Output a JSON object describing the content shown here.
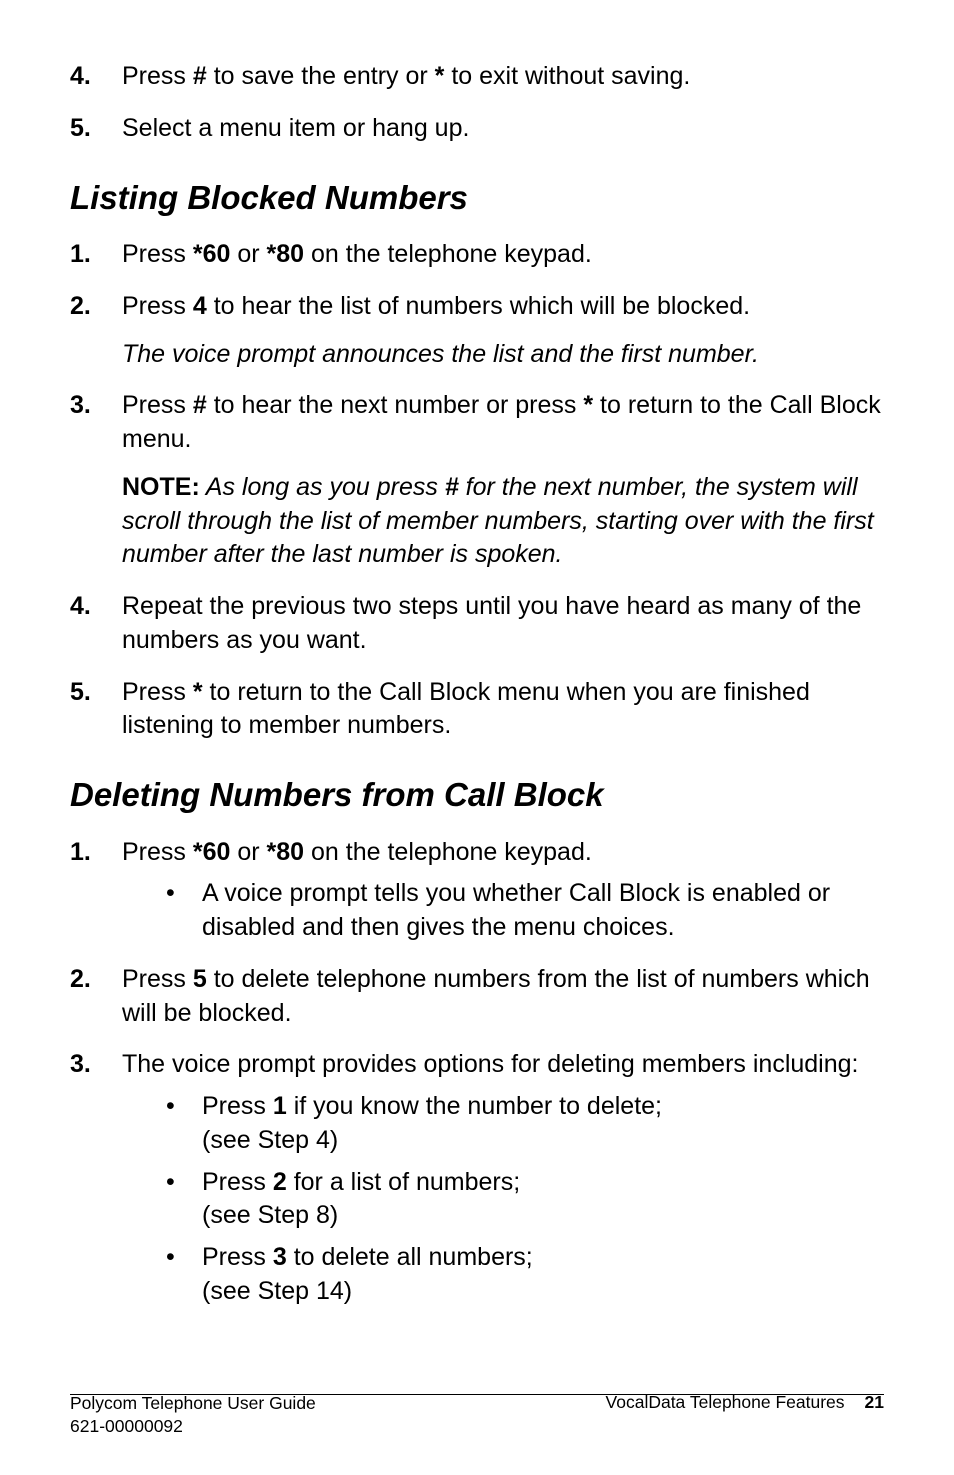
{
  "top": {
    "item4": {
      "num": "4.",
      "text_a": "Press ",
      "b1": "#",
      "text_b": " to save the entry or ",
      "b2": "*",
      "text_c": " to exit without saving."
    },
    "item5": {
      "num": "5.",
      "text": "Select a menu item or hang up."
    }
  },
  "sectionA": {
    "heading": "Listing Blocked Numbers",
    "item1": {
      "num": "1.",
      "t1": "Press ",
      "b1": "*60",
      "t2": " or ",
      "b2": "*80",
      "t3": " on the telephone keypad."
    },
    "item2": {
      "num": "2.",
      "t1": "Press ",
      "b1": "4",
      "t2": " to hear the list of numbers which will be blocked.",
      "italic": "The voice prompt announces the list and the first number."
    },
    "item3": {
      "num": "3.",
      "t1": "Press ",
      "b1": "#",
      "t2": " to hear the next number or press ",
      "b2": "*",
      "t3": " to return to the Call Block menu.",
      "note_label": "NOTE:",
      "note_i1": " As long as you press ",
      "note_b": "#",
      "note_i2": " for the next number, the system will scroll through the list of member numbers, starting over with the first number after the last number is spoken."
    },
    "item4": {
      "num": "4.",
      "text": "Repeat the previous two steps until you have heard as many of the numbers as you want."
    },
    "item5": {
      "num": "5.",
      "t1": "Press ",
      "b1": "*",
      "t2": " to return to the Call Block menu when you are finished listening to member numbers."
    }
  },
  "sectionB": {
    "heading": "Deleting Numbers from Call Block",
    "item1": {
      "num": "1.",
      "t1": "Press ",
      "b1": "*60",
      "t2": " or ",
      "b2": "*80",
      "t3": " on the telephone keypad.",
      "bullet": "A voice prompt tells you whether Call Block is enabled or disabled and then gives the menu choices."
    },
    "item2": {
      "num": "2.",
      "t1": "Press ",
      "b1": "5",
      "t2": " to delete telephone numbers from the list of numbers which will be blocked."
    },
    "item3": {
      "num": "3.",
      "text": "The voice prompt provides options for deleting members including:",
      "bullet1": {
        "t1": "Press ",
        "b1": "1",
        "t2": " if you know the number to delete;",
        "ref": "(see Step 4)"
      },
      "bullet2": {
        "t1": "Press ",
        "b1": "2",
        "t2": " for a list of numbers;",
        "ref": "(see Step 8)"
      },
      "bullet3": {
        "t1": "Press ",
        "b1": "3",
        "t2": " to delete all numbers;",
        "ref": "(see Step 14)"
      }
    }
  },
  "footer": {
    "left1": "Polycom Telephone User Guide",
    "left2": "621-00000092",
    "right": "VocalData Telephone Features",
    "page": "21"
  },
  "bullet_glyph": "•"
}
